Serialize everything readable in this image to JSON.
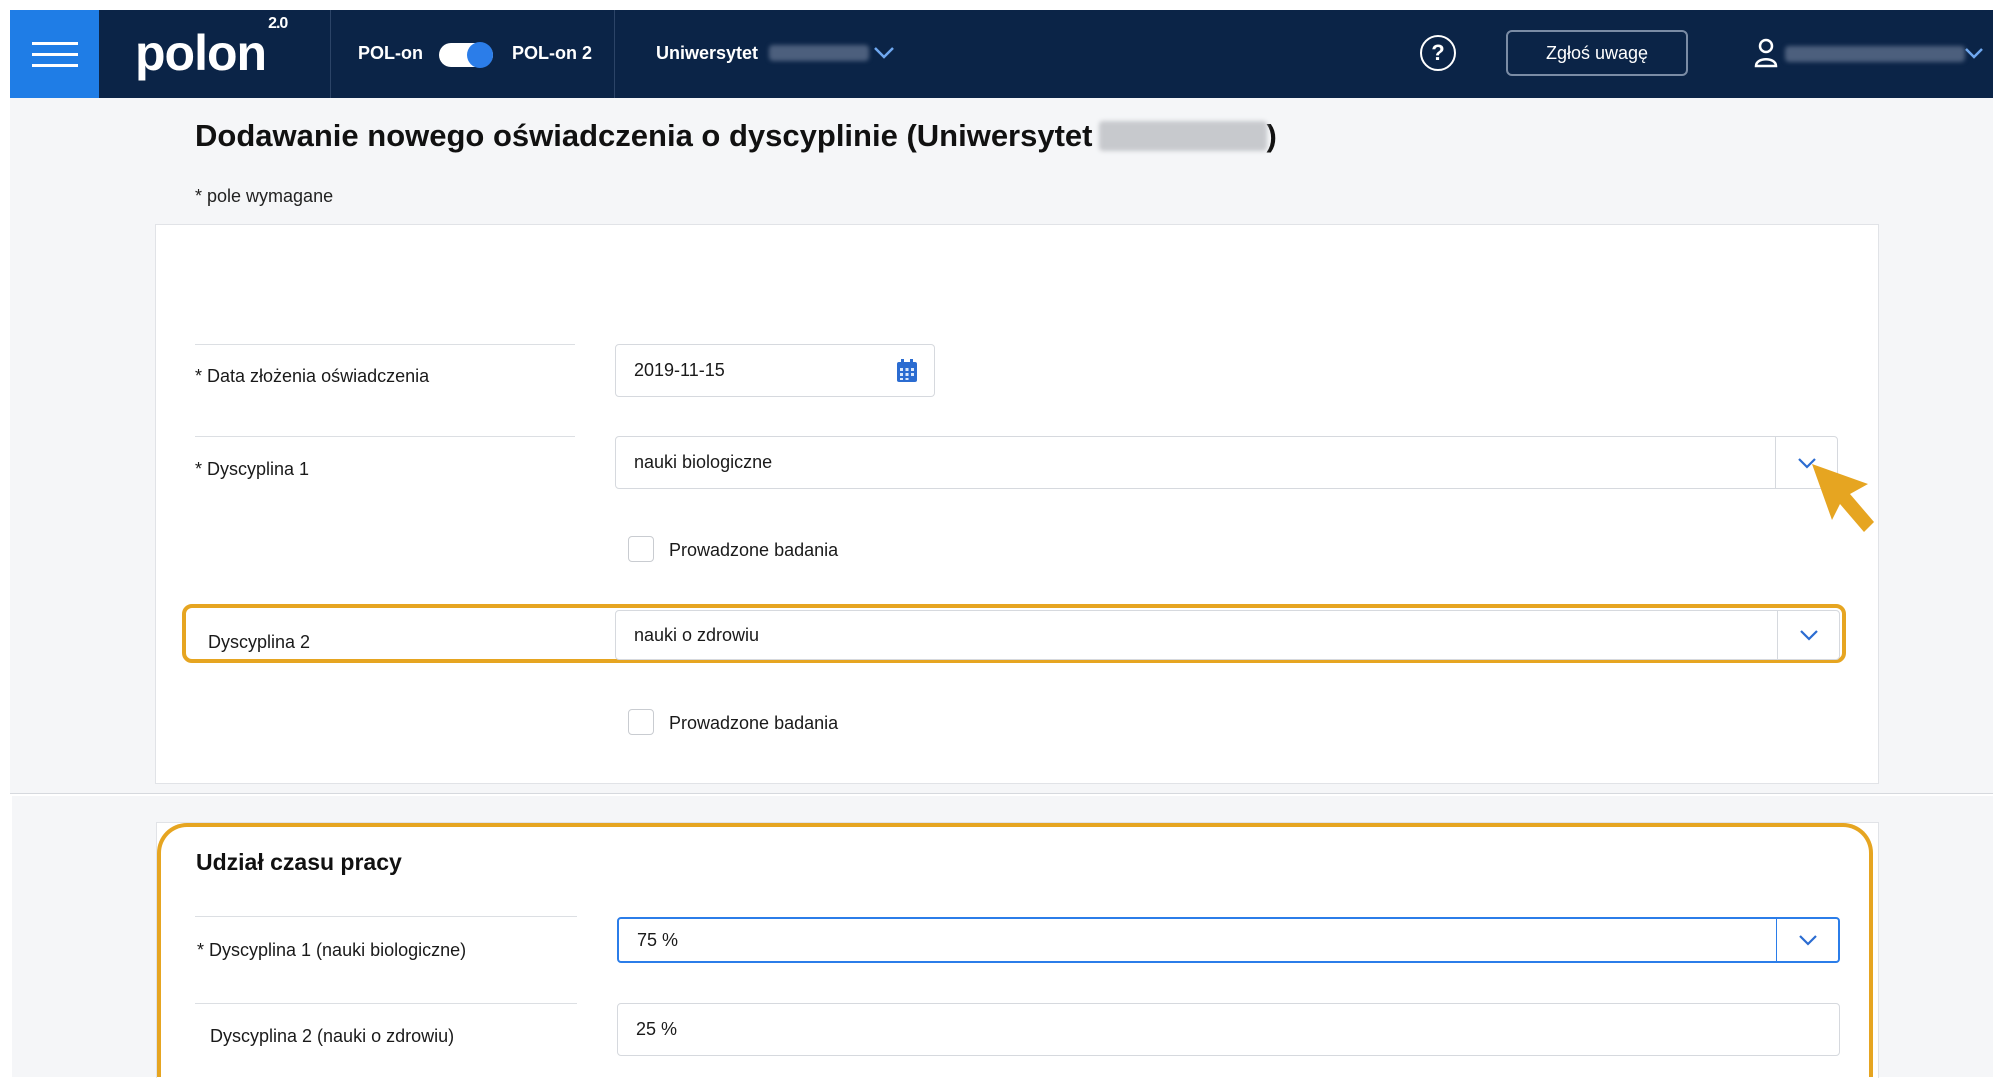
{
  "header": {
    "logo": "polon",
    "logo_version": "2.0",
    "switch_left_label": "POL-on",
    "switch_right_label": "POL-on 2",
    "institution_label": "Uniwersytet",
    "report_button": "Zgłoś uwagę",
    "help_symbol": "?"
  },
  "page": {
    "title_prefix": "Dodawanie nowego oświadczenia o dyscyplinie (Uniwersytet",
    "title_suffix": ")",
    "required_note": "* pole wymagane"
  },
  "form": {
    "date_label": "* Data złożenia oświadczenia",
    "date_value": "2019-11-15",
    "discipline1_label": "* Dyscyplina 1",
    "discipline1_value": "nauki biologiczne",
    "discipline1_checkbox_label": "Prowadzone badania",
    "discipline2_label": "Dyscyplina 2",
    "discipline2_value": "nauki o zdrowiu",
    "discipline2_checkbox_label": "Prowadzone badania"
  },
  "worktime": {
    "section_title": "Udział czasu pracy",
    "discipline1_label": "* Dyscyplina 1 (nauki biologiczne)",
    "discipline1_value": "75 %",
    "discipline2_label": "Dyscyplina 2 (nauki o zdrowiu)",
    "discipline2_value": "25 %"
  },
  "icons": {
    "menu": "hamburger-icon",
    "help": "help-icon",
    "user": "user-icon",
    "calendar": "calendar-icon",
    "dropdown": "chevron-down-icon",
    "pointer": "arrow-cursor-icon"
  },
  "colors": {
    "topbar": "#0b2447",
    "menu_button": "#1f7de6",
    "highlight": "#e6a521",
    "accent_blue": "#2b7de9"
  }
}
